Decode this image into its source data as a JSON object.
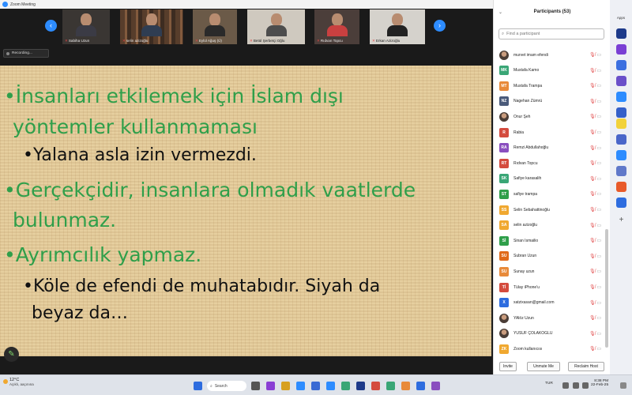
{
  "window": {
    "title": "Zoom Meeting"
  },
  "video_strip": {
    "participants": [
      {
        "name": "Sabiha Uzun"
      },
      {
        "name": "selin azizoğlu"
      },
      {
        "name": "Eylül Ağuş (Ü)"
      },
      {
        "name": "Betül Şerbetçi Oğlu"
      },
      {
        "name": "Rıdvan Topcu"
      },
      {
        "name": "Erkan Azizoğlu"
      }
    ]
  },
  "recording": {
    "label": "Recording..."
  },
  "slide": {
    "line1": "•İnsanları etkilemek için İslam dışı",
    "line2": "yöntemler kullanmaması",
    "line3": "•Yalana asla izin vermezdi.",
    "line4": "•Gerçekçidir, insanlara olmadık vaatlerde",
    "line5": "bulunmaz.",
    "line6": "•Ayrımcılık yapmaz.",
    "line7": "•Köle de efendi de muhatabıdır. Siyah da",
    "line8": "beyaz da…"
  },
  "panel": {
    "title": "Participants (53)",
    "search_placeholder": "Find a participant",
    "participants": [
      {
        "initials": "",
        "name": "murvet imam efendi",
        "color": "#7a5c4e"
      },
      {
        "initials": "MK",
        "name": "Mustafa Kamo",
        "color": "#3aa676"
      },
      {
        "initials": "MT",
        "name": "Mustafa Trampa",
        "color": "#e88a3a"
      },
      {
        "initials": "NZ",
        "name": "Nagehan Zümrü",
        "color": "#4a5a7a"
      },
      {
        "initials": "",
        "name": "Onur Şeh",
        "color": "#5b6470"
      },
      {
        "initials": "R",
        "name": "Rabia",
        "color": "#d44b3e"
      },
      {
        "initials": "RA",
        "name": "Remzi Abdullahoğlu",
        "color": "#8a4fbf"
      },
      {
        "initials": "RT",
        "name": "Rıdvan Topcu",
        "color": "#d44b3e"
      },
      {
        "initials": "SK",
        "name": "Safiye karasalih",
        "color": "#3aa676"
      },
      {
        "initials": "ST",
        "name": "safiye trampa",
        "color": "#2f9f4a"
      },
      {
        "initials": "SS",
        "name": "Selin Sebahattinoğlu",
        "color": "#f0a830"
      },
      {
        "initials": "SA",
        "name": "selin azizoğlu",
        "color": "#f0a830"
      },
      {
        "initials": "Sİ",
        "name": "Sinan İsmailio",
        "color": "#2f9f4a"
      },
      {
        "initials": "SU",
        "name": "Subran Uzun",
        "color": "#e06a1a"
      },
      {
        "initials": "SU",
        "name": "Sunay uzun",
        "color": "#e88a3a"
      },
      {
        "initials": "Tİ",
        "name": "Tülay iPhone'u",
        "color": "#d44b3e"
      },
      {
        "initials": "X",
        "name": "xatzixasan@gmail.com",
        "color": "#2d6cdf"
      },
      {
        "initials": "",
        "name": "YAlöz Uzun",
        "color": "#5b6470"
      },
      {
        "initials": "",
        "name": "YUSUF ÇOLAKOĞLU",
        "color": "#222222"
      },
      {
        "initials": "ZK",
        "name": "Zoom kullanıcısı",
        "color": "#f0a830"
      }
    ],
    "footer": {
      "invite": "Invite",
      "unmute": "Unmute Me",
      "reclaim": "Reclaim Host"
    }
  },
  "apps": {
    "title": "Apps"
  },
  "taskbar": {
    "weather_temp": "12°C",
    "weather_desc": "Açıklı, aaçınına",
    "search_label": "Search",
    "tray_lang": "TUR",
    "time": "8:38 PM",
    "date": "22-Feb-25"
  },
  "colors": {
    "accent": "#2d8cff",
    "slide_green": "#2f9f4a",
    "mute_red": "#e04646"
  }
}
